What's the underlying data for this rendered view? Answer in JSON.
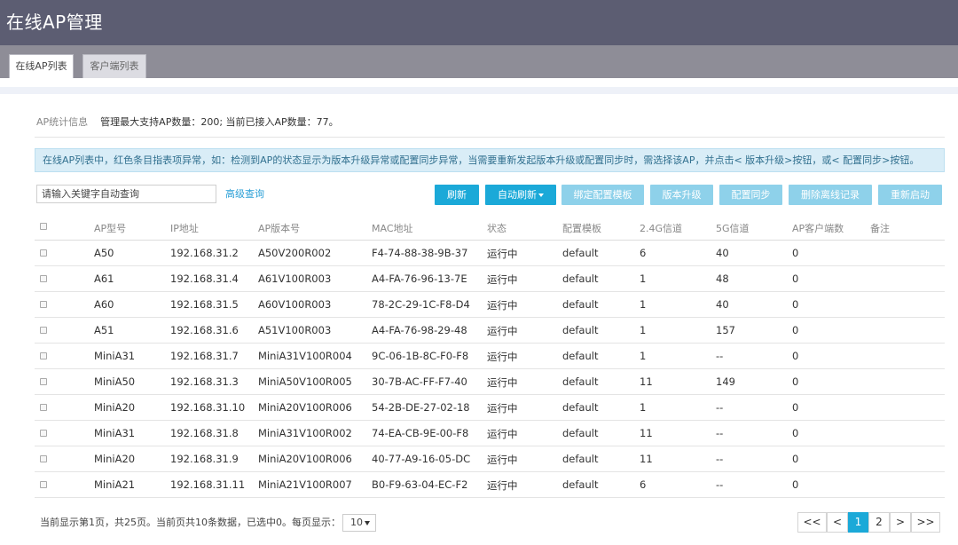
{
  "header": {
    "title": "在线AP管理"
  },
  "tabs": [
    {
      "label": "在线AP列表"
    },
    {
      "label": "客户端列表"
    }
  ],
  "stats": {
    "label": "AP统计信息",
    "value": "管理最大支持AP数量：200; 当前已接入AP数量：77。"
  },
  "notice": "在线AP列表中，红色条目指表项异常，如：检测到AP的状态显示为版本升级异常或配置同步异常，当需要重新发起版本升级或配置同步时，需选择该AP，并点击< 版本升级>按钮，或< 配置同步>按钮。",
  "search": {
    "placeholder": "请输入关键字自动查询",
    "advanced": "高级查询"
  },
  "toolbar": {
    "refresh": "刷新",
    "auto_refresh": "自动刷新",
    "bind_template": "绑定配置模板",
    "upgrade": "版本升级",
    "sync": "配置同步",
    "delete_offline": "删除离线记录",
    "restart": "重新启动"
  },
  "table": {
    "columns": [
      "AP型号",
      "IP地址",
      "AP版本号",
      "MAC地址",
      "状态",
      "配置模板",
      "2.4G信道",
      "5G信道",
      "AP客户端数",
      "备注"
    ],
    "rows": [
      [
        "A50",
        "192.168.31.2",
        "A50V200R002",
        "F4-74-88-38-9B-37",
        "运行中",
        "default",
        "6",
        "40",
        "0",
        ""
      ],
      [
        "A61",
        "192.168.31.4",
        "A61V100R003",
        "A4-FA-76-96-13-7E",
        "运行中",
        "default",
        "1",
        "48",
        "0",
        ""
      ],
      [
        "A60",
        "192.168.31.5",
        "A60V100R003",
        "78-2C-29-1C-F8-D4",
        "运行中",
        "default",
        "1",
        "40",
        "0",
        ""
      ],
      [
        "A51",
        "192.168.31.6",
        "A51V100R003",
        "A4-FA-76-98-29-48",
        "运行中",
        "default",
        "1",
        "157",
        "0",
        ""
      ],
      [
        "MiniA31",
        "192.168.31.7",
        "MiniA31V100R004",
        "9C-06-1B-8C-F0-F8",
        "运行中",
        "default",
        "1",
        "--",
        "0",
        ""
      ],
      [
        "MiniA50",
        "192.168.31.3",
        "MiniA50V100R005",
        "30-7B-AC-FF-F7-40",
        "运行中",
        "default",
        "11",
        "149",
        "0",
        ""
      ],
      [
        "MiniA20",
        "192.168.31.10",
        "MiniA20V100R006",
        "54-2B-DE-27-02-18",
        "运行中",
        "default",
        "1",
        "--",
        "0",
        ""
      ],
      [
        "MiniA31",
        "192.168.31.8",
        "MiniA31V100R002",
        "74-EA-CB-9E-00-F8",
        "运行中",
        "default",
        "11",
        "--",
        "0",
        ""
      ],
      [
        "MiniA20",
        "192.168.31.9",
        "MiniA20V100R006",
        "40-77-A9-16-05-DC",
        "运行中",
        "default",
        "11",
        "--",
        "0",
        ""
      ],
      [
        "MiniA21",
        "192.168.31.11",
        "MiniA21V100R007",
        "B0-F9-63-04-EC-F2",
        "运行中",
        "default",
        "6",
        "--",
        "0",
        ""
      ]
    ]
  },
  "footer": {
    "info": "当前显示第1页，共25页。当前页共10条数据，已选中0。每页显示：",
    "page_size": "10"
  },
  "pagination": [
    "<<",
    "<",
    "1",
    "2",
    ">",
    ">>"
  ],
  "pagination_active": "1",
  "colors": {
    "header_bg": "#5c5d72",
    "tab_bar_bg": "#8e8d97",
    "accent": "#1ba9d8",
    "accent_disabled": "#8ed1ea",
    "notice_bg": "#d9edf7"
  }
}
